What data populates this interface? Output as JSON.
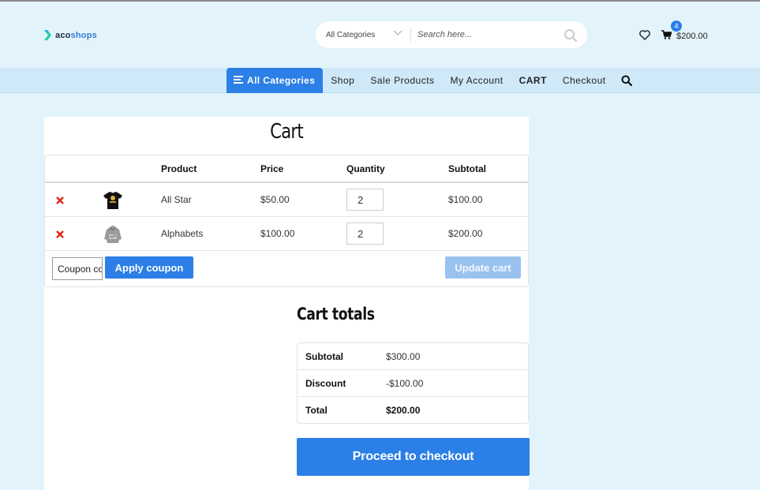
{
  "header": {
    "logo": {
      "part1": "aco",
      "part2": "shops"
    },
    "search": {
      "category_label": "All Categories",
      "placeholder": "Search here..."
    },
    "cart": {
      "count": "4",
      "total": "$200.00"
    }
  },
  "nav": {
    "all_categories": "All Categories",
    "items": [
      "Shop",
      "Sale Products",
      "My Account",
      "CART",
      "Checkout"
    ]
  },
  "cart_page": {
    "title": "Cart",
    "columns": {
      "product": "Product",
      "price": "Price",
      "quantity": "Quantity",
      "subtotal": "Subtotal"
    },
    "rows": [
      {
        "product": "All Star",
        "price": "$50.00",
        "quantity": "2",
        "subtotal": "$100.00"
      },
      {
        "product": "Alphabets",
        "price": "$100.00",
        "quantity": "2",
        "subtotal": "$200.00"
      }
    ],
    "coupon_placeholder": "Coupon code",
    "apply_coupon": "Apply coupon",
    "update_cart": "Update cart"
  },
  "totals": {
    "title": "Cart totals",
    "rows": [
      {
        "label": "Subtotal",
        "value": "$300.00"
      },
      {
        "label": "Discount",
        "value": "-$100.00"
      },
      {
        "label": "Total",
        "value": "$200.00"
      }
    ],
    "checkout": "Proceed to checkout"
  },
  "colors": {
    "accent": "#2b7fe6",
    "background": "#e3f3fb",
    "nav_bg": "#cfe9f8",
    "remove": "#e2231a"
  }
}
